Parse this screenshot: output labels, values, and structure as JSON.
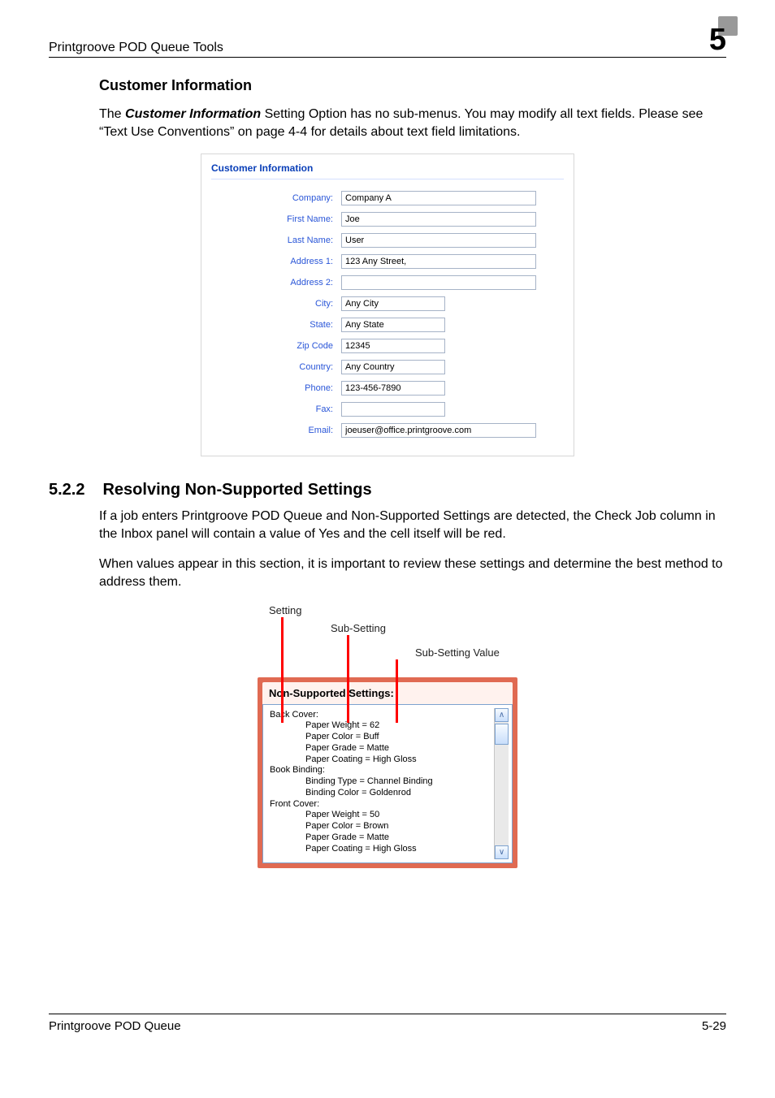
{
  "header": {
    "running_title": "Printgroove POD Queue Tools",
    "chapter_number": "5"
  },
  "section_customer": {
    "heading": "Customer Information",
    "para1_before": "The ",
    "para1_strong": "Customer Information",
    "para1_after": " Setting Option has no sub-menus. You may modify all text fields. Please see “Text Use Conventions” on page 4-4 for details about text field limitations.",
    "form": {
      "title": "Customer Information",
      "labels": {
        "company": "Company:",
        "first_name": "First Name:",
        "last_name": "Last Name:",
        "address1": "Address 1:",
        "address2": "Address 2:",
        "city": "City:",
        "state": "State:",
        "zip": "Zip Code",
        "country": "Country:",
        "phone": "Phone:",
        "fax": "Fax:",
        "email": "Email:"
      },
      "values": {
        "company": "Company A",
        "first_name": "Joe",
        "last_name": "User",
        "address1": "123 Any Street,",
        "address2": "",
        "city": "Any City",
        "state": "Any State",
        "zip": "12345",
        "country": "Any Country",
        "phone": "123-456-7890",
        "fax": "",
        "email": "joeuser@office.printgroove.com"
      }
    }
  },
  "section_522": {
    "number": "5.2.2",
    "title": "Resolving Non-Supported Settings",
    "para1": "If a job enters Printgroove POD Queue and Non-Supported Settings are detected, the Check Job column in the Inbox panel will contain a value of Yes and the cell itself will be red.",
    "para2": "When values appear in this section, it is important to review these settings and determine the best method to address them.",
    "diagram_labels": {
      "setting": "Setting",
      "subsetting": "Sub-Setting",
      "subsetting_value": "Sub-Setting Value"
    },
    "nss_panel": {
      "header": "Non-Supported Settings:",
      "items": {
        "cat1": "Back Cover:",
        "l1a": "Paper Weight = 62",
        "l1b": "Paper Color = Buff",
        "l1c": "Paper Grade = Matte",
        "l1d": "Paper Coating = High Gloss",
        "cat2": "Book Binding:",
        "l2a": "Binding Type = Channel Binding",
        "l2b": "Binding Color = Goldenrod",
        "cat3": "Front Cover:",
        "l3a": "Paper Weight = 50",
        "l3b": "Paper Color = Brown",
        "l3c": "Paper Grade = Matte",
        "l3d": "Paper Coating = High Gloss"
      },
      "scroll": {
        "up": "∧",
        "down": "∨"
      }
    }
  },
  "footer": {
    "product": "Printgroove POD Queue",
    "page_number": "5-29"
  }
}
